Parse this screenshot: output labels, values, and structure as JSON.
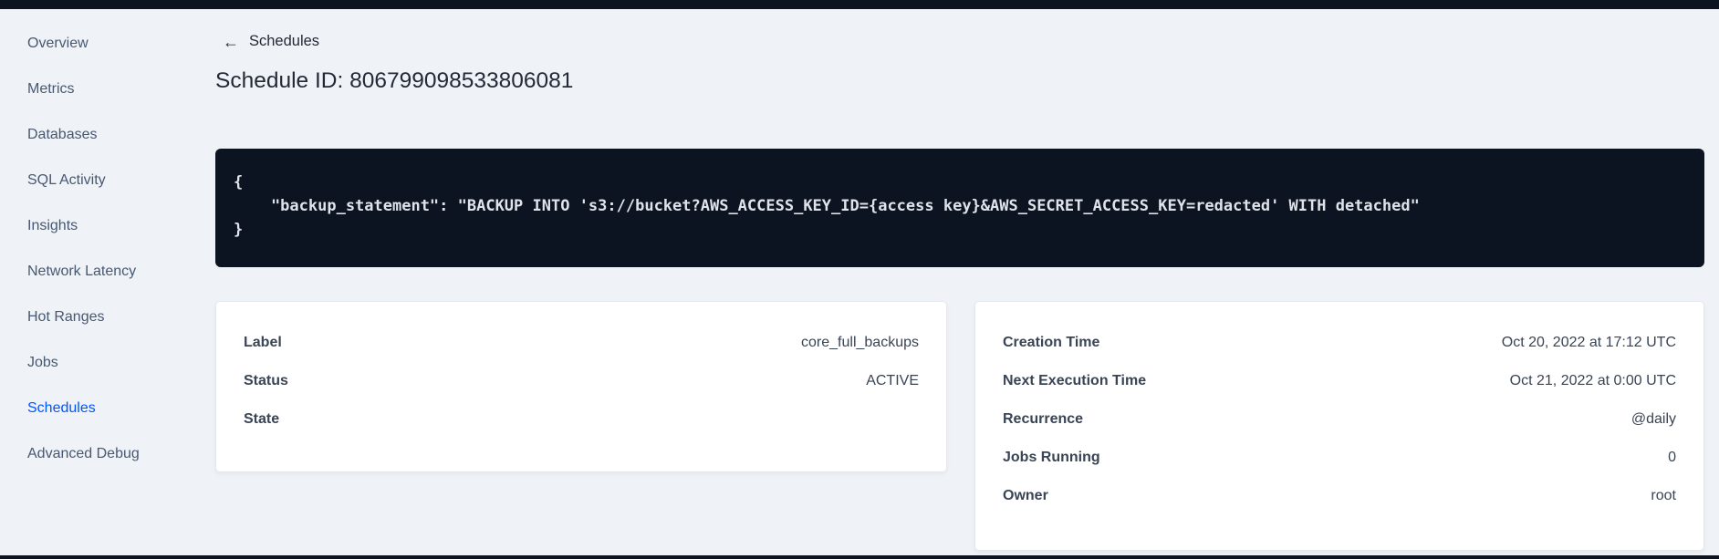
{
  "colors": {
    "page-bg": "#eff3f7",
    "dark": "#0d1421",
    "card-bg": "#ffffff",
    "card-border": "#e4eaf1",
    "text-primary": "#242a35",
    "text-secondary": "#394455",
    "sidebar-text": "#475872",
    "accent-blue": "#0055ff",
    "code-text": "#dfe3ea"
  },
  "sidebar": {
    "items": [
      {
        "label": "Overview",
        "active": false
      },
      {
        "label": "Metrics",
        "active": false
      },
      {
        "label": "Databases",
        "active": false
      },
      {
        "label": "SQL Activity",
        "active": false
      },
      {
        "label": "Insights",
        "active": false
      },
      {
        "label": "Network Latency",
        "active": false
      },
      {
        "label": "Hot Ranges",
        "active": false
      },
      {
        "label": "Jobs",
        "active": false
      },
      {
        "label": "Schedules",
        "active": true
      },
      {
        "label": "Advanced Debug",
        "active": false
      }
    ]
  },
  "header": {
    "back_arrow_icon": "←",
    "back_link_label": "Schedules",
    "page_title": "Schedule ID: 806799098533806081"
  },
  "code_block": {
    "lines": [
      "{",
      "    \"backup_statement\": \"BACKUP INTO 's3://bucket?AWS_ACCESS_KEY_ID={access key}&AWS_SECRET_ACCESS_KEY=redacted' WITH detached\"",
      "}"
    ]
  },
  "details_card": {
    "rows": [
      {
        "label": "Label",
        "value": "core_full_backups"
      },
      {
        "label": "Status",
        "value": "ACTIVE"
      },
      {
        "label": "State",
        "value": ""
      }
    ]
  },
  "schedule_card": {
    "rows": [
      {
        "label": "Creation Time",
        "value": "Oct 20, 2022 at 17:12 UTC"
      },
      {
        "label": "Next Execution Time",
        "value": "Oct 21, 2022 at 0:00 UTC"
      },
      {
        "label": "Recurrence",
        "value": "@daily"
      },
      {
        "label": "Jobs Running",
        "value": "0"
      },
      {
        "label": "Owner",
        "value": "root"
      }
    ]
  }
}
